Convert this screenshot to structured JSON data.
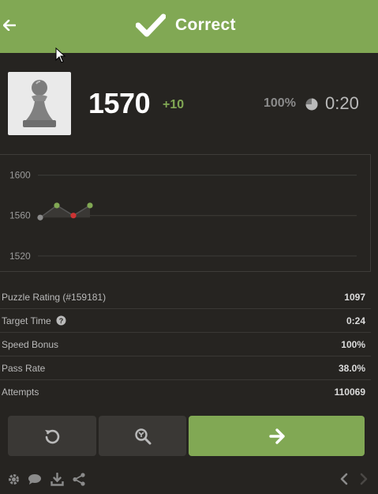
{
  "header": {
    "title": "Correct",
    "back_icon": "arrow-left-icon",
    "status_icon": "checkmark-icon",
    "bg_color": "#81a854"
  },
  "puzzle": {
    "piece_icon": "white-pawn-icon",
    "rating": "1570",
    "rating_change": "+10",
    "accuracy": "100%",
    "timer": "0:20"
  },
  "chart_data": {
    "type": "line",
    "y_ticks": [
      "1600",
      "1560",
      "1520"
    ],
    "ylim": [
      1505,
      1620
    ],
    "points": [
      {
        "y": 1558,
        "result": "loss"
      },
      {
        "y": 1570,
        "result": "win"
      },
      {
        "y": 1560,
        "result": "fail"
      },
      {
        "y": 1570,
        "result": "win"
      }
    ],
    "colors": {
      "win": "#81a854",
      "fail": "#c33",
      "neutral": "#8b8b8b"
    }
  },
  "stats": [
    {
      "label": "Puzzle Rating (#159181)",
      "value": "1097"
    },
    {
      "label": "Target Time",
      "value": "0:24",
      "has_help": true
    },
    {
      "label": "Speed Bonus",
      "value": "100%"
    },
    {
      "label": "Pass Rate",
      "value": "38.0%"
    },
    {
      "label": "Attempts",
      "value": "110069"
    }
  ],
  "actions": {
    "retry_icon": "retry-icon",
    "analyze_icon": "analyze-icon",
    "next_icon": "arrow-right-icon"
  },
  "footer": {
    "icons": [
      "gear-icon",
      "chat-icon",
      "download-icon",
      "share-icon"
    ],
    "nav": [
      "chevron-left-icon",
      "chevron-right-icon"
    ]
  }
}
